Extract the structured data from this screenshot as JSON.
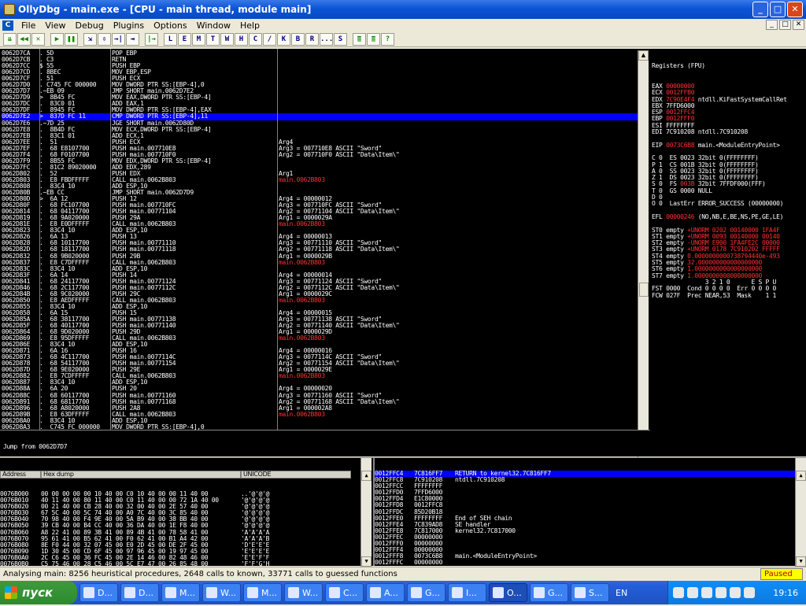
{
  "window": {
    "title": "OllyDbg - main.exe - [CPU - main thread, module main]",
    "buttons": [
      "_",
      "□",
      "✕"
    ]
  },
  "menu": [
    "File",
    "View",
    "Debug",
    "Plugins",
    "Options",
    "Window",
    "Help"
  ],
  "mdi_buttons": [
    "_",
    "□",
    "✕"
  ],
  "toolbar": [
    "⇊",
    "◀◀",
    "✕",
    "▶",
    "❚❚",
    "⇲",
    "⇳",
    "→|",
    "⇥",
    "|→",
    "L",
    "E",
    "M",
    "T",
    "W",
    "H",
    "C",
    "/",
    "K",
    "B",
    "R",
    "...",
    "S",
    "≣",
    "≣",
    "?"
  ],
  "disasm": [
    [
      "0062D7CA",
      ". 5D",
      "POP EBP",
      ""
    ],
    [
      "0062D7CB",
      ". C3",
      "RETN",
      ""
    ],
    [
      "0062D7CC",
      "$ 55",
      "PUSH EBP",
      ""
    ],
    [
      "0062D7CD",
      ". 8BEC",
      "MOV EBP,ESP",
      ""
    ],
    [
      "0062D7CF",
      ". 51",
      "PUSH ECX",
      ""
    ],
    [
      "0062D7D0",
      ". C745 FC 000000",
      "MOV DWORD PTR SS:[EBP-4],0",
      ""
    ],
    [
      "0062D7D7",
      ".~EB 09",
      "JMP SHORT main.0062D7E2",
      ""
    ],
    [
      "0062D7D9",
      ">  8B45 FC",
      "MOV EAX,DWORD PTR SS:[EBP-4]",
      ""
    ],
    [
      "0062D7DC",
      ".  83C0 01",
      "ADD EAX,1",
      ""
    ],
    [
      "0062D7DF",
      ".  8945 FC",
      "MOV DWORD PTR SS:[EBP-4],EAX",
      ""
    ],
    [
      "0062D7E2",
      ">  837D FC 11",
      "CMP DWORD PTR SS:[EBP-4],11",
      ""
    ],
    [
      "0062D7E6",
      ".~7D 25",
      "JGE SHORT main.0062D80D",
      ""
    ],
    [
      "0062D7E8",
      ".  8B4D FC",
      "MOV ECX,DWORD PTR SS:[EBP-4]",
      ""
    ],
    [
      "0062D7EB",
      ".  83C1 01",
      "ADD ECX,1",
      ""
    ],
    [
      "0062D7EE",
      ".  51",
      "PUSH ECX",
      "Arg4"
    ],
    [
      "0062D7EF",
      ".  68 E8107700",
      "PUSH main.007710E8",
      "Arg3 = 007710E8 ASCII \"Sword\""
    ],
    [
      "0062D7F4",
      ".  68 F0107700",
      "PUSH main.007710F0",
      "Arg2 = 007710F0 ASCII \"Data\\Item\\\""
    ],
    [
      "0062D7F9",
      ".  8B55 FC",
      "MOV EDX,DWORD PTR SS:[EBP-4]",
      ""
    ],
    [
      "0062D7FC",
      ".  81C2 89020000",
      "ADD EDX,289",
      ""
    ],
    [
      "0062D802",
      ".  52",
      "PUSH EDX",
      "Arg1"
    ],
    [
      "0062D803",
      ".  E8 FBDFFFFF",
      "CALL main.0062B803",
      "main.0062B803"
    ],
    [
      "0062D808",
      ".  83C4 10",
      "ADD ESP,10",
      ""
    ],
    [
      "0062D80B",
      ".~EB CC",
      "JMP SHORT main.0062D7D9",
      ""
    ],
    [
      "0062D80D",
      ">  6A 12",
      "PUSH 12",
      "Arg4 = 00000012"
    ],
    [
      "0062D80F",
      ".  68 FC107700",
      "PUSH main.007710FC",
      "Arg3 = 007710FC ASCII \"Sword\""
    ],
    [
      "0062D814",
      ".  68 04117700",
      "PUSH main.00771104",
      "Arg2 = 00771104 ASCII \"Data\\Item\\\""
    ],
    [
      "0062D819",
      ".  68 9A020000",
      "PUSH 29A",
      "Arg1 = 0000029A"
    ],
    [
      "0062D81E",
      ".  E8 E0DFFFFF",
      "CALL main.0062B803",
      "main.0062B803"
    ],
    [
      "0062D823",
      ".  83C4 10",
      "ADD ESP,10",
      ""
    ],
    [
      "0062D826",
      ".  6A 13",
      "PUSH 13",
      "Arg4 = 00000013"
    ],
    [
      "0062D828",
      ".  68 10117700",
      "PUSH main.00771110",
      "Arg3 = 00771110 ASCII \"Sword\""
    ],
    [
      "0062D82D",
      ".  68 18117700",
      "PUSH main.00771118",
      "Arg2 = 00771118 ASCII \"Data\\Item\\\""
    ],
    [
      "0062D832",
      ".  68 9B020000",
      "PUSH 29B",
      "Arg1 = 0000029B"
    ],
    [
      "0062D837",
      ".  E8 C7DFFFFF",
      "CALL main.0062B803",
      "main.0062B803"
    ],
    [
      "0062D83C",
      ".  83C4 10",
      "ADD ESP,10",
      ""
    ],
    [
      "0062D83F",
      ".  6A 14",
      "PUSH 14",
      "Arg4 = 00000014"
    ],
    [
      "0062D841",
      ".  68 24117700",
      "PUSH main.00771124",
      "Arg3 = 00771124 ASCII \"Sword\""
    ],
    [
      "0062D846",
      ".  68 2C117700",
      "PUSH main.0077112C",
      "Arg2 = 0077112C ASCII \"Data\\Item\\\""
    ],
    [
      "0062D84B",
      ".  68 9C020000",
      "PUSH 29C",
      "Arg1 = 0000029C"
    ],
    [
      "0062D850",
      ".  E8 AEDFFFFF",
      "CALL main.0062B803",
      "main.0062B803"
    ],
    [
      "0062D855",
      ".  83C4 10",
      "ADD ESP,10",
      ""
    ],
    [
      "0062D858",
      ".  6A 15",
      "PUSH 15",
      "Arg4 = 00000015"
    ],
    [
      "0062D85A",
      ".  68 38117700",
      "PUSH main.00771138",
      "Arg3 = 00771138 ASCII \"Sword\""
    ],
    [
      "0062D85F",
      ".  68 40117700",
      "PUSH main.00771140",
      "Arg2 = 00771140 ASCII \"Data\\Item\\\""
    ],
    [
      "0062D864",
      ".  68 9D020000",
      "PUSH 29D",
      "Arg1 = 0000029D"
    ],
    [
      "0062D869",
      ".  E8 95DFFFFF",
      "CALL main.0062B803",
      "main.0062B803"
    ],
    [
      "0062D86E",
      ".  83C4 10",
      "ADD ESP,10",
      ""
    ],
    [
      "0062D871",
      ".  6A 16",
      "PUSH 16",
      "Arg4 = 00000016"
    ],
    [
      "0062D873",
      ".  68 4C117700",
      "PUSH main.0077114C",
      "Arg3 = 0077114C ASCII \"Sword\""
    ],
    [
      "0062D878",
      ".  68 54117700",
      "PUSH main.00771154",
      "Arg2 = 00771154 ASCII \"Data\\Item\\\""
    ],
    [
      "0062D87D",
      ".  68 9E020000",
      "PUSH 29E",
      "Arg1 = 0000029E"
    ],
    [
      "0062D882",
      ".  E8 7CDFFFFF",
      "CALL main.0062B803",
      "main.0062B803"
    ],
    [
      "0062D887",
      ".  83C4 10",
      "ADD ESP,10",
      ""
    ],
    [
      "0062D88A",
      ".  6A 20",
      "PUSH 20",
      "Arg4 = 00000020"
    ],
    [
      "0062D88C",
      ".  68 60117700",
      "PUSH main.00771160",
      "Arg3 = 00771160 ASCII \"Sword\""
    ],
    [
      "0062D891",
      ".  68 68117700",
      "PUSH main.00771168",
      "Arg2 = 00771168 ASCII \"Data\\Item\\\""
    ],
    [
      "0062D896",
      ".  68 A8020000",
      "PUSH 2A8",
      "Arg1 = 000002A8"
    ],
    [
      "0062D89B",
      ".  E8 63DFFFFF",
      "CALL main.0062B803",
      "main.0062B803"
    ],
    [
      "0062D8A0",
      ".  83C4 10",
      "ADD ESP,10",
      ""
    ],
    [
      "0062D8A3",
      ".  C745 FC 000000",
      "MOV DWORD PTR SS:[EBP-4],0",
      ""
    ],
    [
      "0062D8AA",
      ".~EB 09",
      "JMP SHORT main.0062D8B5",
      ""
    ]
  ],
  "disasm_selected_index": 10,
  "registers_header": "Registers (FPU)",
  "registers": [
    {
      "t": "EAX ",
      "v": "00000000",
      "r": true,
      "c": ""
    },
    {
      "t": "ECX ",
      "v": "0012FFB0",
      "r": true,
      "c": ""
    },
    {
      "t": "EDX ",
      "v": "7C90E4F4",
      "r": true,
      "c": " ntdll.KiFastSystemCallRet"
    },
    {
      "t": "EBX ",
      "v": "7FFD6000",
      "r": false,
      "c": ""
    },
    {
      "t": "ESP ",
      "v": "0012FFC4",
      "r": true,
      "c": ""
    },
    {
      "t": "EBP ",
      "v": "0012FFF0",
      "r": true,
      "c": ""
    },
    {
      "t": "ESI ",
      "v": "FFFFFFFF",
      "r": false,
      "c": ""
    },
    {
      "t": "EDI ",
      "v": "7C910208",
      "r": false,
      "c": " ntdll.7C910208"
    },
    {
      "t": "",
      "v": "",
      "r": false,
      "c": ""
    },
    {
      "t": "EIP ",
      "v": "0073C6B8",
      "r": true,
      "c": " main.<ModuleEntryPoint>"
    },
    {
      "t": "",
      "v": "",
      "r": false,
      "c": ""
    },
    {
      "t": "C 0  ES ",
      "v": "0023",
      "r": false,
      "c": " 32bit 0(FFFFFFFF)"
    },
    {
      "t": "P 1  CS ",
      "v": "001B",
      "r": false,
      "c": " 32bit 0(FFFFFFFF)"
    },
    {
      "t": "A 0  SS ",
      "v": "0023",
      "r": false,
      "c": " 32bit 0(FFFFFFFF)"
    },
    {
      "t": "Z 1  DS ",
      "v": "0023",
      "r": false,
      "c": " 32bit 0(FFFFFFFF)"
    },
    {
      "t": "S 0  FS ",
      "v": "003B",
      "r": true,
      "c": " 32bit 7FFDF000(FFF)"
    },
    {
      "t": "T 0  GS ",
      "v": "0000",
      "r": false,
      "c": " NULL"
    },
    {
      "t": "D 0",
      "v": "",
      "r": false,
      "c": ""
    },
    {
      "t": "O 0  LastErr ",
      "v": "ERROR_SUCCESS",
      "r": false,
      "c": " (00000000)"
    },
    {
      "t": "",
      "v": "",
      "r": false,
      "c": ""
    },
    {
      "t": "EFL ",
      "v": "00000246",
      "r": true,
      "c": " (NO,NB,E,BE,NS,PE,GE,LE)"
    },
    {
      "t": "",
      "v": "",
      "r": false,
      "c": ""
    },
    {
      "t": "ST0 empty ",
      "v": "+UNORM 0202 00140000 1FA4F",
      "r": true,
      "c": ""
    },
    {
      "t": "ST1 empty ",
      "v": "+UNORM 0093 00140000 00140",
      "r": true,
      "c": ""
    },
    {
      "t": "ST2 empty ",
      "v": "-UNORM E900 1FA4FE2C 00000",
      "r": true,
      "c": ""
    },
    {
      "t": "ST3 empty ",
      "v": "+UNORM 0178 7C910202 FFFFF",
      "r": true,
      "c": ""
    },
    {
      "t": "ST4 empty ",
      "v": "0.0000000000738794440e-493",
      "r": true,
      "c": ""
    },
    {
      "t": "ST5 empty ",
      "v": "32.000000000000000000",
      "r": true,
      "c": ""
    },
    {
      "t": "ST6 empty ",
      "v": "1.0000000000000000000",
      "r": true,
      "c": ""
    },
    {
      "t": "ST7 empty ",
      "v": "1.0000000000000000000",
      "r": true,
      "c": ""
    },
    {
      "t": "               3 2 1 0      E S P U",
      "v": "",
      "r": false,
      "c": ""
    },
    {
      "t": "FST 0000  Cond 0 0 0 0  Err 0 0 0 0",
      "v": "",
      "r": false,
      "c": ""
    },
    {
      "t": "FCW 027F  Prec NEAR,53  Mask    1 1",
      "v": "",
      "r": false,
      "c": ""
    }
  ],
  "info_text": "Jump from 0062D7D7",
  "hex_headers": [
    "Address",
    "Hex dump",
    "UNICODE"
  ],
  "hex_rows": [
    [
      "0076B000",
      "00 00 00 00 00 10 40 00 C0 10 40 00 00 11 40 00",
      "..'@'@'@"
    ],
    [
      "0076B010",
      "40 11 40 00 80 11 40 00 C0 11 40 00 00 72 1A 40 00",
      "'@'@'@'@"
    ],
    [
      "0076B020",
      "00 21 40 00 CB 28 40 00 32 00 40 00 2E 57 40 00",
      "'@'@'@'@"
    ],
    [
      "0076B030",
      "67 5C 40 00 5C 74 40 00 A0 7C 40 00 3C 85 40 00",
      "'@'@'@'@"
    ],
    [
      "0076B040",
      "70 98 40 00 F4 9E 40 00 5A B9 40 00 38 BB 40 00",
      "'@'@'@'@"
    ],
    [
      "0076B050",
      "39 CB 40 00 B4 CC 40 00 36 DA 40 00 1E F8 40 00",
      "'@'@'@'@"
    ],
    [
      "0076B060",
      "A8 22 41 00 89 3B 41 00 89 4B 41 00 78 58 41 00",
      "'A'A'A'A"
    ],
    [
      "0076B070",
      "95 61 41 00 B5 62 41 00 F0 62 41 00 B1 A4 42 00",
      "'A'A'A'B"
    ],
    [
      "0076B080",
      "8E F0 44 00 32 07 45 00 E0 2D 45 00 DE 2F 45 00",
      "'D'E'E'E"
    ],
    [
      "0076B090",
      "1D 30 45 00 CD 6F 45 00 97 96 45 00 19 97 45 00",
      "'E'E'E'E"
    ],
    [
      "0076B0A0",
      "2C C6 45 00 36 FC 45 00 2E 14 46 00 82 48 46 00",
      "'E'E'F'F"
    ],
    [
      "0076B0B0",
      "C5 75 46 00 28 C5 46 00 5C E7 47 00 26 85 48 00",
      "'F'F'G'H"
    ],
    [
      "0076B0C0",
      "F0 BF 48 00 B0 C8 48 00 35 C7 48 00 F2 D2 48 00",
      "'H'H'H'H"
    ],
    [
      "0076B0D0",
      "30 D8 48 00 E4 DB 48 00 90 DC 48 00 F5 EF 48 00",
      "'H'H'H'H"
    ],
    [
      "0076B0E0",
      "71 FB 48 00 93 08 49 00 F4 19 49 00 B3 39 49 00",
      "'H'I'I'I"
    ],
    [
      "0076B0F0",
      "F4 49 49 00 CC 57 49 00 68 68 49 00 5C 6E 49 00",
      "'I'I'I'I"
    ]
  ],
  "stack_rows": [
    [
      "0012FFC4",
      "7C816FF7",
      "RETURN to kernel32.7C816FF7"
    ],
    [
      "0012FFC8",
      "7C910208",
      "ntdll.7C910208"
    ],
    [
      "0012FFCC",
      "FFFFFFFF",
      ""
    ],
    [
      "0012FFD0",
      "7FFD6000",
      ""
    ],
    [
      "0012FFD4",
      "E1C80000",
      ""
    ],
    [
      "0012FFD8",
      "0012FFC8",
      ""
    ],
    [
      "0012FFDC",
      "85D20B18",
      ""
    ],
    [
      "0012FFE0",
      "FFFFFFFF",
      "End of SEH chain"
    ],
    [
      "0012FFE4",
      "7C839AD8",
      "SE handler"
    ],
    [
      "0012FFE8",
      "7C817000",
      "kernel32.7C817000"
    ],
    [
      "0012FFEC",
      "00000000",
      ""
    ],
    [
      "0012FFF0",
      "00000000",
      ""
    ],
    [
      "0012FFF4",
      "00000000",
      ""
    ],
    [
      "0012FFF8",
      "0073C6B8",
      "main.<ModuleEntryPoint>"
    ],
    [
      "0012FFFC",
      "00000000",
      ""
    ]
  ],
  "stack_selected_index": 0,
  "status": {
    "text": "Analysing main: 8256 heuristical procedures, 2648 calls to known, 33771 calls to guessed functions",
    "state": "Paused"
  },
  "taskbar": {
    "start_label": "пуск",
    "tasks": [
      "D...",
      "D...",
      "M...",
      "W...",
      "M...",
      "W...",
      "C...",
      "A...",
      "G...",
      "I...",
      "O...",
      "G...",
      "S..."
    ],
    "active_task_index": 10,
    "lang": "EN",
    "clock": "19:16"
  },
  "colors": {
    "accent": "#0000ff",
    "red_text": "#ff3030",
    "paused_bg": "#ffff00"
  }
}
